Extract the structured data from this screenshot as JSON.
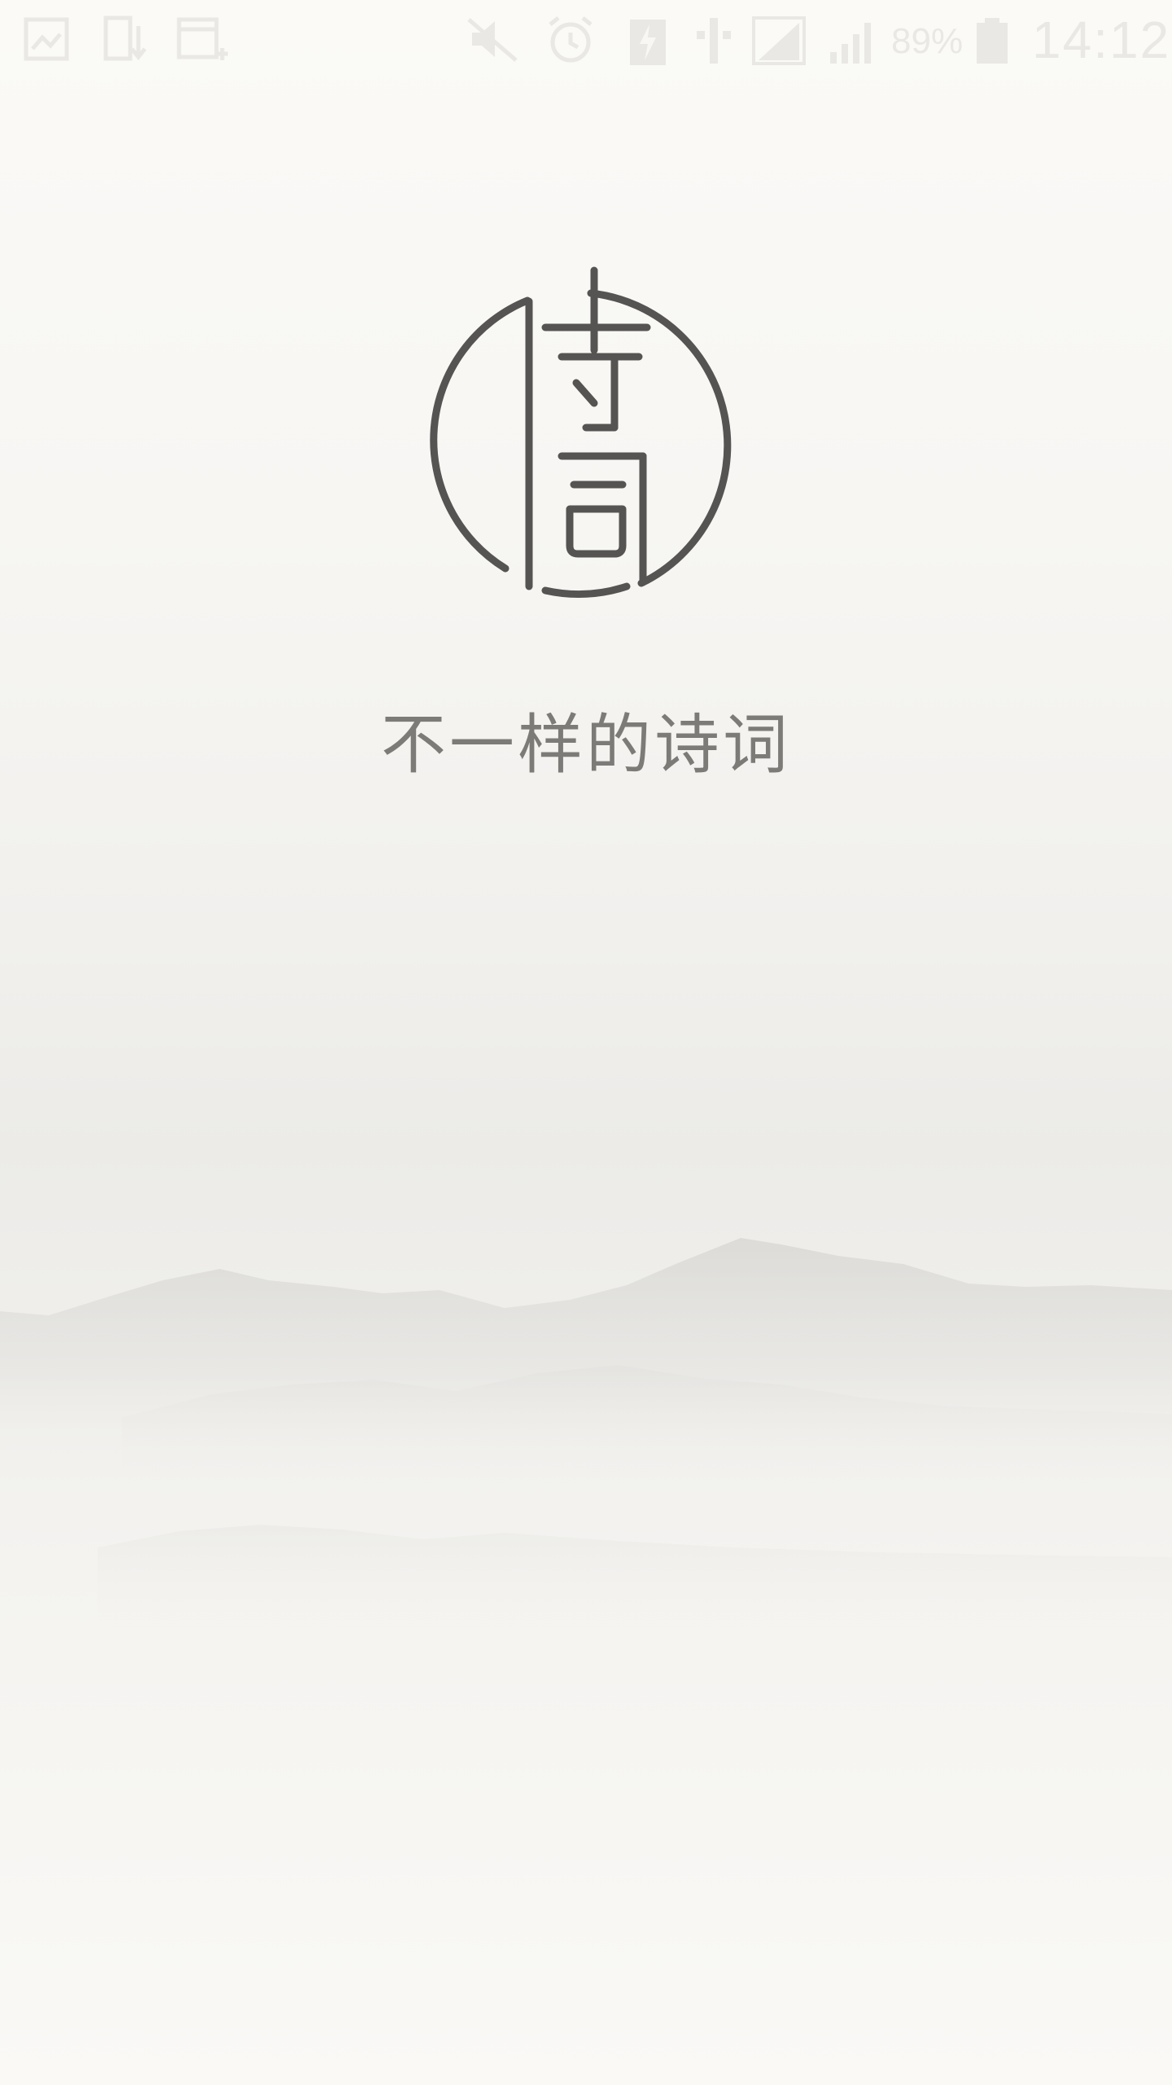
{
  "status_bar": {
    "battery_percent": "89%",
    "time": "14:12",
    "icons": [
      "gallery-icon",
      "download-icon",
      "calendar-add-icon",
      "mute-icon",
      "alarm-icon",
      "charging-icon",
      "signal-1-icon",
      "signal-2-icon",
      "signal-3-icon",
      "battery-icon"
    ]
  },
  "splash": {
    "logo_icon": "shi-ci-logo-icon",
    "slogan": "不一样的诗词"
  },
  "colors": {
    "background": "#faf9f6",
    "logo": "#555452",
    "slogan": "#7d7b78",
    "status_bar_icons": "#e9e8e5"
  }
}
